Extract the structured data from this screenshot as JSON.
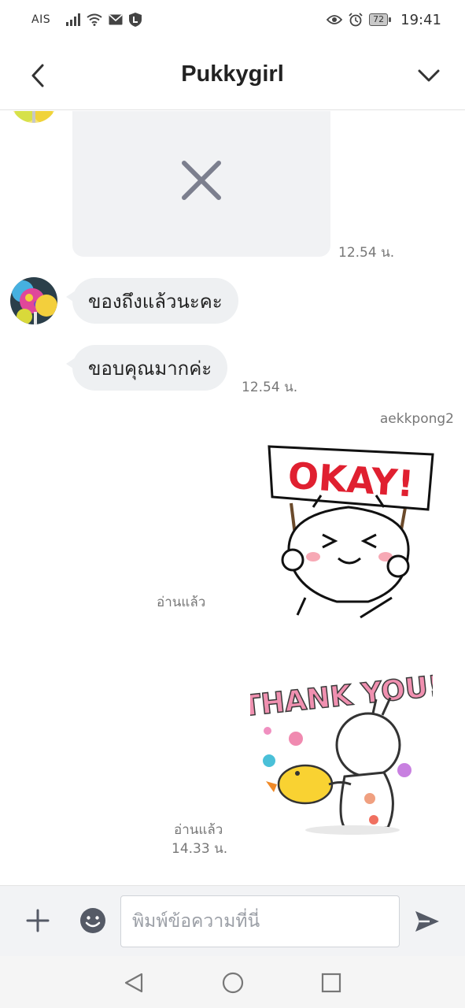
{
  "status_bar": {
    "carrier": "AIS",
    "battery": "72",
    "time": "19:41",
    "icons": [
      "signal-icon",
      "wifi-icon",
      "mail-icon",
      "line-shield-icon",
      "eye-icon",
      "alarm-icon",
      "battery-icon"
    ]
  },
  "header": {
    "title": "Pukkygirl",
    "back_icon": "chevron-left-icon",
    "menu_icon": "chevron-down-icon"
  },
  "messages": [
    {
      "type": "image-failed",
      "time": "12.54 น.",
      "icon": "close-icon"
    },
    {
      "type": "text",
      "text": "ของถึงแล้วนะคะ"
    },
    {
      "type": "text",
      "text": "ขอบคุณมากค่ะ",
      "time": "12.54 น."
    },
    {
      "type": "sticker",
      "sender": "aekkpong2",
      "sticker_text": "OKAY!",
      "status": "อ่านแล้ว"
    },
    {
      "type": "sticker",
      "sticker_text": "THANK YOU!",
      "status": "อ่านแล้ว",
      "time": "14.33 น."
    }
  ],
  "input_bar": {
    "placeholder": "พิมพ์ข้อความที่นี่",
    "icons": [
      "plus-icon",
      "emoji-icon",
      "send-icon"
    ]
  },
  "colors": {
    "bubble": "#eef0f2",
    "placeholder_bg": "#f1f2f4",
    "icon_gray": "#6d7180",
    "sticker_red": "#e02030"
  }
}
